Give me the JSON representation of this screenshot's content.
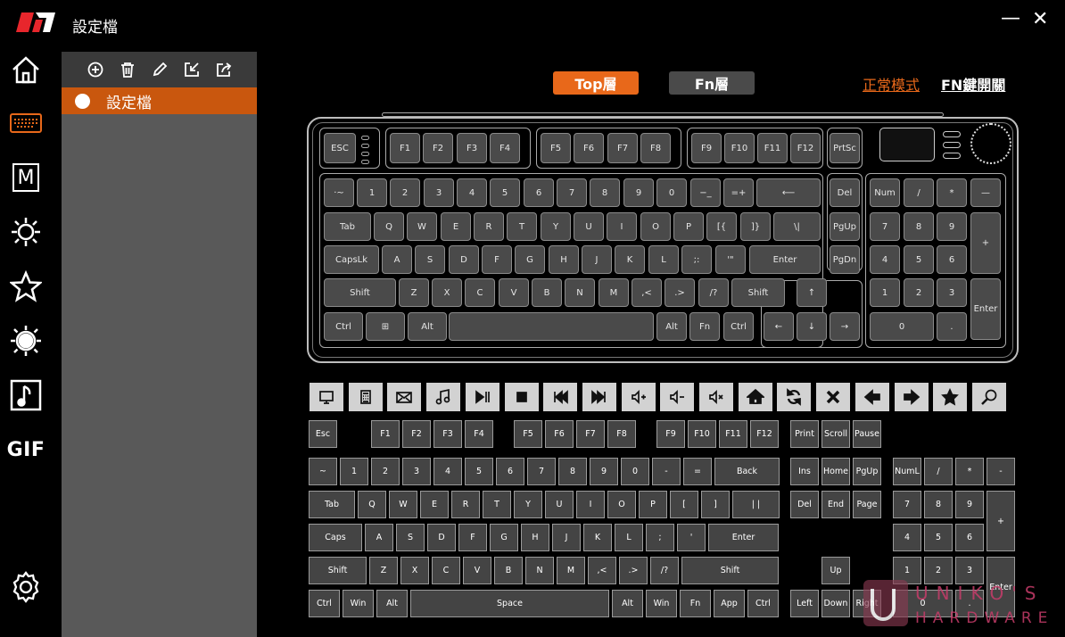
{
  "app": {
    "title": "設定檔"
  },
  "window": {
    "minimize_glyph": "—",
    "close_glyph": "✕"
  },
  "nav": {
    "items": [
      {
        "icon": "home-icon"
      },
      {
        "icon": "keyboard-icon"
      },
      {
        "icon": "macro-icon",
        "label": "M"
      },
      {
        "icon": "lighting-icon"
      },
      {
        "icon": "star-icon"
      },
      {
        "icon": "brightness-icon"
      },
      {
        "icon": "music-icon"
      },
      {
        "icon": "gif-icon",
        "label": "GIF"
      },
      {
        "icon": "gear-icon"
      }
    ]
  },
  "profiles": {
    "toolbar": [
      "add-icon",
      "trash-icon",
      "pencil-icon",
      "import-icon",
      "export-icon"
    ],
    "items": [
      {
        "label": "設定檔",
        "selected": true
      }
    ]
  },
  "layers": {
    "top": "Top層",
    "fn": "Fn層"
  },
  "modes": {
    "normal": "正常模式",
    "fn_switch": "FN鍵開關"
  },
  "colors": {
    "accent": "#e8681a",
    "selected_profile": "#c9570e",
    "sidebar": "#595959"
  },
  "keyboard_rows": [
    [
      "ESC",
      "F1",
      "F2",
      "F3",
      "F4",
      "F5",
      "F6",
      "F7",
      "F8",
      "F9",
      "F10",
      "F11",
      "F12",
      "PrtSc"
    ],
    [
      "·~",
      "1",
      "2",
      "3",
      "4",
      "5",
      "6",
      "7",
      "8",
      "9",
      "0",
      "−_",
      "=+",
      "⟵",
      "Del",
      "Num",
      "/",
      "*",
      "—"
    ],
    [
      "Tab",
      "Q",
      "W",
      "E",
      "R",
      "T",
      "Y",
      "U",
      "I",
      "O",
      "P",
      "[{",
      "]}",
      "\\|",
      "PgUp",
      "7",
      "8",
      "9",
      "+"
    ],
    [
      "CapsLk",
      "A",
      "S",
      "D",
      "F",
      "G",
      "H",
      "J",
      "K",
      "L",
      ";:",
      "'\"",
      "Enter",
      "PgDn",
      "4",
      "5",
      "6"
    ],
    [
      "Shift",
      "Z",
      "X",
      "C",
      "V",
      "B",
      "N",
      "M",
      ",<",
      ".>",
      "/?",
      "Shift",
      "↑",
      "1",
      "2",
      "3",
      "Enter"
    ],
    [
      "Ctrl",
      "⊞",
      "Alt",
      "",
      "Alt",
      "Fn",
      "Ctrl",
      "←",
      "↓",
      "→",
      "0",
      "."
    ]
  ],
  "function_icons": [
    "monitor-icon",
    "calculator-icon",
    "mail-icon",
    "music-note-icon",
    "play-pause-icon",
    "stop-icon",
    "previous-track-icon",
    "next-track-icon",
    "volume-up-icon",
    "volume-down-icon",
    "mute-icon",
    "home-icon",
    "refresh-icon",
    "close-icon",
    "arrow-left-icon",
    "arrow-right-icon",
    "star-icon",
    "search-icon"
  ],
  "palette": {
    "row0": [
      "Esc",
      "F1",
      "F2",
      "F3",
      "F4",
      "F5",
      "F6",
      "F7",
      "F8",
      "F9",
      "F10",
      "F11",
      "F12",
      "Print",
      "Scroll",
      "Pause"
    ],
    "row1": [
      "~",
      "1",
      "2",
      "3",
      "4",
      "5",
      "6",
      "7",
      "8",
      "9",
      "0",
      "-",
      "=",
      "Back",
      "Ins",
      "Home",
      "PgUp",
      "NumL",
      "/",
      "*",
      "-"
    ],
    "row2": [
      "Tab",
      "Q",
      "W",
      "E",
      "R",
      "T",
      "Y",
      "U",
      "I",
      "O",
      "P",
      "[",
      "]",
      "| |",
      "Del",
      "End",
      "Page",
      "7",
      "8",
      "9",
      "+"
    ],
    "row3": [
      "Caps",
      "A",
      "S",
      "D",
      "F",
      "G",
      "H",
      "J",
      "K",
      "L",
      ";",
      "'",
      "Enter",
      "4",
      "5",
      "6"
    ],
    "row4": [
      "Shift",
      "Z",
      "X",
      "C",
      "V",
      "B",
      "N",
      "M",
      ",<",
      ".>",
      "/?",
      "Shift",
      "Up",
      "1",
      "2",
      "3",
      "Enter"
    ],
    "row5": [
      "Ctrl",
      "Win",
      "Alt",
      "Space",
      "Alt",
      "Win",
      "Fn",
      "App",
      "Ctrl",
      "Left",
      "Down",
      "Right",
      "0",
      "."
    ]
  },
  "watermark": {
    "text": "UNIKO'S",
    "sub": "HARDWARE"
  }
}
